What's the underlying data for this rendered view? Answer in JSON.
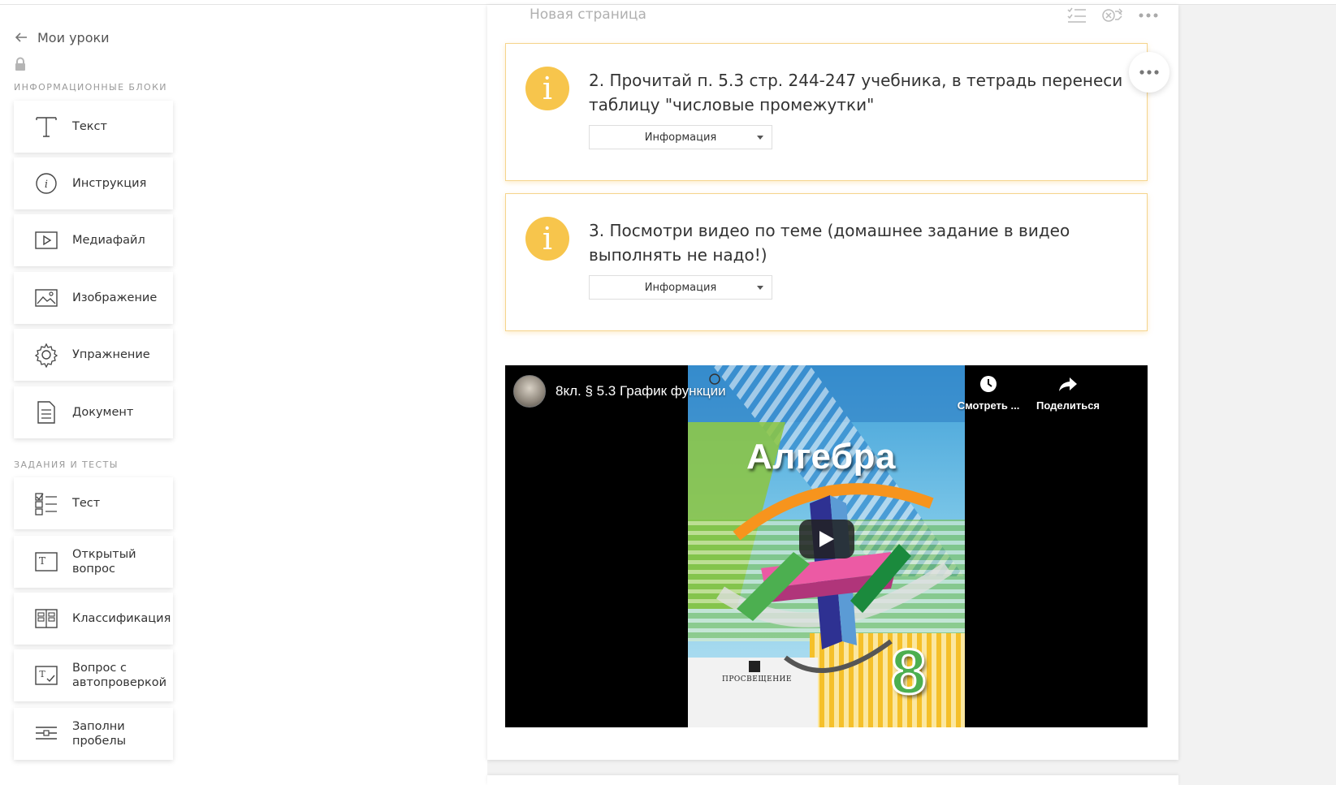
{
  "sidebar": {
    "back_label": "Мои уроки",
    "section_info": "Информационные блоки",
    "section_tasks": "Задания и тесты",
    "info_items": [
      {
        "label": "Текст",
        "icon": "text-t-icon"
      },
      {
        "label": "Инструкция",
        "icon": "info-circle-icon"
      },
      {
        "label": "Медиафайл",
        "icon": "play-box-icon"
      },
      {
        "label": "Изображение",
        "icon": "image-icon"
      },
      {
        "label": "Упражнение",
        "icon": "gear-icon"
      },
      {
        "label": "Документ",
        "icon": "document-icon"
      }
    ],
    "task_items": [
      {
        "label": "Тест",
        "icon": "checklist-icon"
      },
      {
        "label": "Открытый\nвопрос",
        "icon": "open-question-icon"
      },
      {
        "label": "Классификация",
        "icon": "classification-icon"
      },
      {
        "label": "Вопрос с\nавтопроверкой",
        "icon": "auto-check-icon"
      },
      {
        "label": "Заполни\nпробелы",
        "icon": "fill-gaps-icon"
      }
    ]
  },
  "page": {
    "title": "Новая страница"
  },
  "blocks": [
    {
      "text": "2. Прочитай п. 5.3 стр. 244-247 учебника, в тетрадь перенеси таблицу \"числовые промежутки\"",
      "type_label": "Информация"
    },
    {
      "text": "3. Посмотри видео по теме (домашнее задание в видео выполнять не надо!)",
      "type_label": "Информация"
    }
  ],
  "video": {
    "title": "8кл. § 5.3 График функции",
    "watch_later": "Смотреть ...",
    "share": "Поделиться",
    "cover_title": "Алгебра",
    "cover_grade": "8",
    "cover_publisher": "ПРОСВЕЩЕНИЕ"
  },
  "colors": {
    "info_accent": "#f7c54c",
    "info_border": "#f5d48c"
  }
}
